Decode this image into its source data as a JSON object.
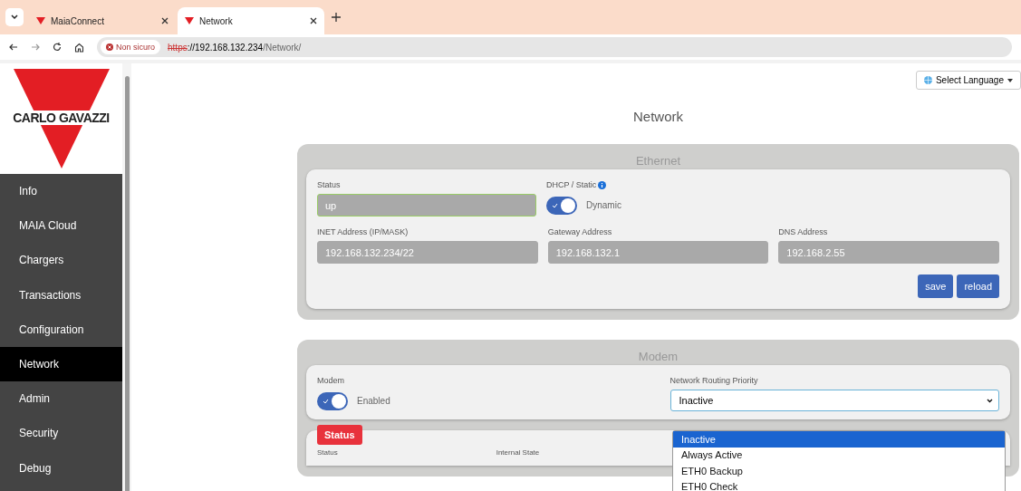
{
  "browser": {
    "tabs": [
      {
        "title": "MaiaConnect",
        "selected": false
      },
      {
        "title": "Network",
        "selected": true
      }
    ],
    "security": "Non sicuro",
    "url_scheme": "https",
    "url_host": "://192.168.132.234",
    "url_path": "/Network/"
  },
  "logo": {
    "text": "CARLO GAVAZZI"
  },
  "sidebar": {
    "items": [
      {
        "label": "Info",
        "selected": false
      },
      {
        "label": "MAIA Cloud",
        "selected": false
      },
      {
        "label": "Chargers",
        "selected": false
      },
      {
        "label": "Transactions",
        "selected": false
      },
      {
        "label": "Configuration",
        "selected": false
      },
      {
        "label": "Network",
        "selected": true
      },
      {
        "label": "Admin",
        "selected": false
      },
      {
        "label": "Security",
        "selected": false
      },
      {
        "label": "Debug",
        "selected": false
      }
    ]
  },
  "language_button": "Select Language",
  "page_title": "Network",
  "ethernet": {
    "title": "Ethernet",
    "status_label": "Status",
    "status_value": "up",
    "dhcp_label": "DHCP / Static",
    "dhcp_on": true,
    "dhcp_text": "Dynamic",
    "fields": [
      {
        "label": "INET Address (IP/MASK)",
        "value": "192.168.132.234/22"
      },
      {
        "label": "Gateway Address",
        "value": "192.168.132.1"
      },
      {
        "label": "DNS Address",
        "value": "192.168.2.55"
      }
    ],
    "buttons": [
      "save",
      "reload"
    ]
  },
  "modem": {
    "title": "Modem",
    "modem_label": "Modem",
    "modem_on": true,
    "modem_text": "Enabled",
    "priority_label": "Network Routing Priority",
    "priority_value": "Inactive",
    "options": [
      {
        "label": "Inactive",
        "selected": true
      },
      {
        "label": "Always Active",
        "selected": false
      },
      {
        "label": "ETH0 Backup",
        "selected": false
      },
      {
        "label": "ETH0 Check",
        "selected": false
      }
    ]
  },
  "status": {
    "badge": "Status",
    "labels": [
      "Status",
      "Internal State"
    ]
  }
}
